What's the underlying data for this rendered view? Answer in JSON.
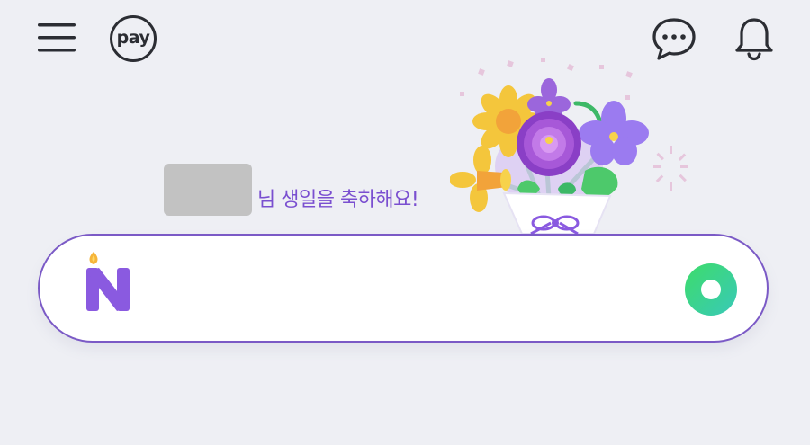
{
  "header": {
    "menu_icon": "hamburger-menu-icon",
    "pay_label": "pay",
    "chat_icon": "chat-bubble-icon",
    "bell_icon": "bell-icon"
  },
  "greeting": {
    "text": "님 생일을 축하해요!"
  },
  "search": {
    "value": "",
    "logo_icon": "birthday-candle-n-logo-icon",
    "action_icon": "green-ring-icon"
  },
  "colors": {
    "background": "#eeeff4",
    "accent_purple": "#7a4fd0",
    "border_purple": "#7b5ac6",
    "green": "#3ed47a",
    "icon_dark": "#2b2d33"
  }
}
